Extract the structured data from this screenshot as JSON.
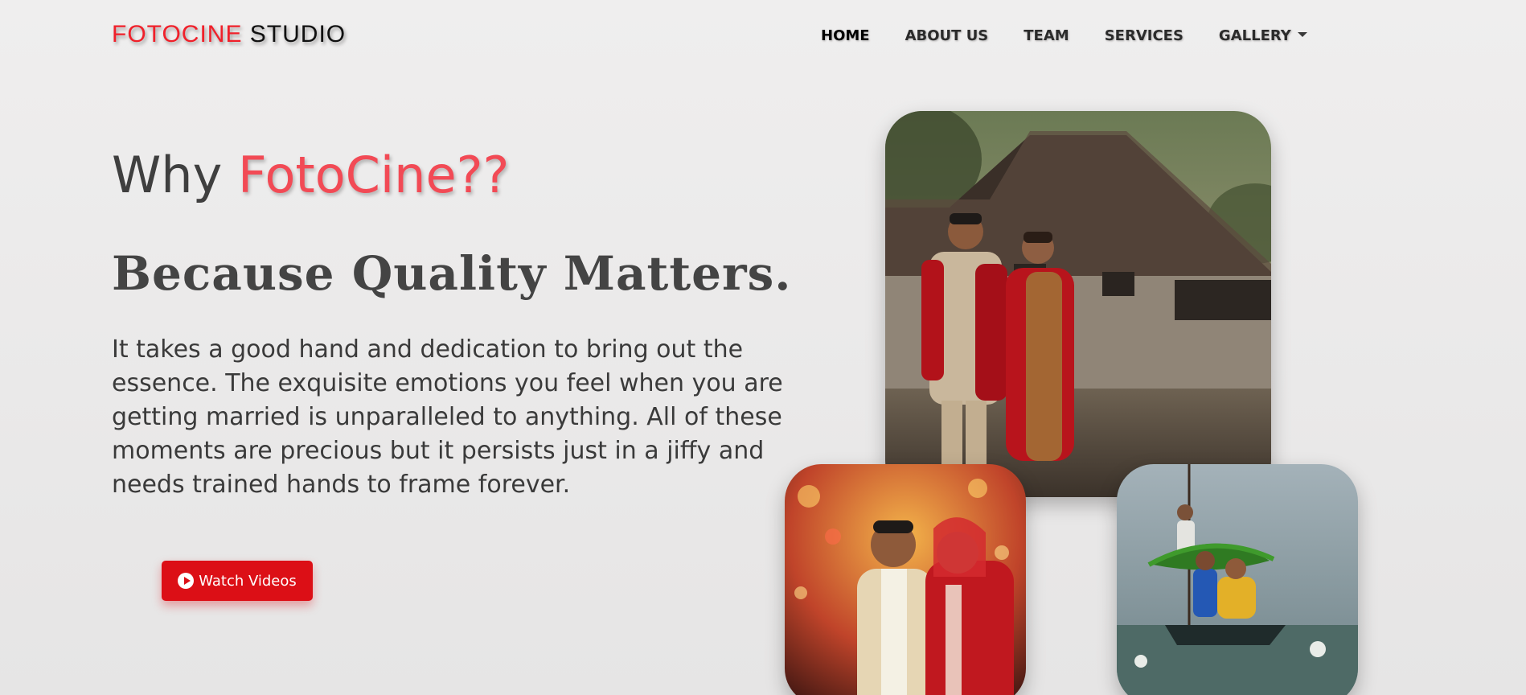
{
  "brand": {
    "part1": "FOTOCINE",
    "part2": " STUDIO"
  },
  "nav": {
    "items": [
      {
        "label": "HOME"
      },
      {
        "label": "ABOUT US"
      },
      {
        "label": "TEAM"
      },
      {
        "label": "SERVICES"
      },
      {
        "label": "GALLERY"
      }
    ]
  },
  "hero": {
    "heading_prefix": "Why ",
    "heading_brand": "FotoCine??",
    "tagline": "Because Quality Matters.",
    "description": "It takes a good hand and dedication to bring out the essence. The exquisite emotions you feel when you are getting married is unparalleled to anything. All of these moments are precious but it persists just in a jiffy and needs trained hands to frame forever.",
    "cta_label": "Watch Videos"
  },
  "colors": {
    "brand_red": "#f0202a",
    "heading_accent": "#f24a55",
    "button_red": "#dc0f16"
  },
  "icons": {
    "cta_icon": "play-circle-icon",
    "gallery_caret": "caret-down-icon"
  }
}
